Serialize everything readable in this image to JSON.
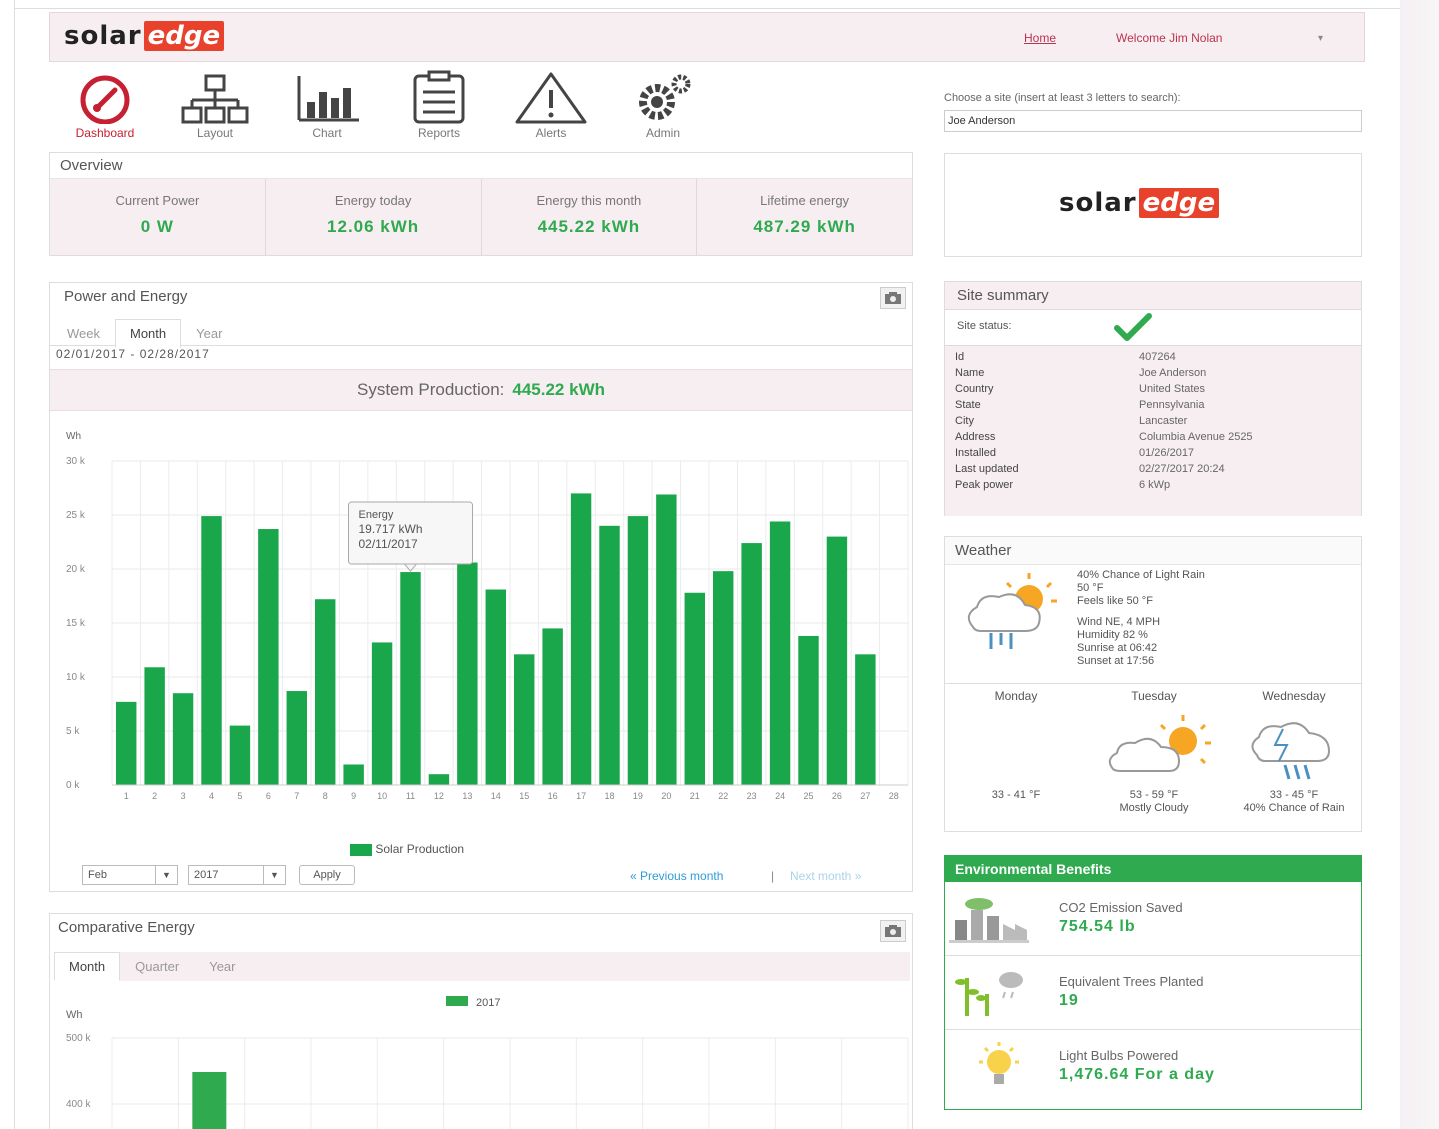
{
  "brand": {
    "solar": "solar",
    "edge": "edge"
  },
  "topbar": {
    "home_label": "Home",
    "welcome_label": "Welcome Jim Nolan",
    "caret": "▾"
  },
  "nav": [
    {
      "label": "Dashboard",
      "icon": "dashboard-icon"
    },
    {
      "label": "Layout",
      "icon": "layout-icon"
    },
    {
      "label": "Chart",
      "icon": "chart-icon"
    },
    {
      "label": "Reports",
      "icon": "reports-icon"
    },
    {
      "label": "Alerts",
      "icon": "alerts-icon"
    },
    {
      "label": "Admin",
      "icon": "admin-icon"
    }
  ],
  "site_chooser": {
    "label": "Choose a site (insert at least 3 letters to search):",
    "value": "Joe Anderson"
  },
  "overview": {
    "title": "Overview",
    "cards": [
      {
        "title": "Current Power",
        "value": "0 W"
      },
      {
        "title": "Energy today",
        "value": "12.06 kWh"
      },
      {
        "title": "Energy this month",
        "value": "445.22 kWh"
      },
      {
        "title": "Lifetime energy",
        "value": "487.29 kWh"
      }
    ]
  },
  "power_energy": {
    "title": "Power and Energy",
    "tabs": [
      "Week",
      "Month",
      "Year"
    ],
    "active_tab": "Month",
    "date_range": "02/01/2017 - 02/28/2017",
    "production_label": "System Production:",
    "production_value": "445.22 kWh",
    "legend": "Solar Production",
    "month_select": "Feb",
    "year_select": "2017",
    "apply_label": "Apply",
    "prev_label": "« Previous month",
    "separator": "|",
    "next_label": "Next month »",
    "tooltip": {
      "line1": "Energy",
      "line2": "19.717 kWh",
      "line3": "02/11/2017"
    }
  },
  "chart_data": [
    {
      "type": "bar",
      "ylabel": "Wh",
      "ylim": [
        0,
        30000
      ],
      "y_ticks": [
        "0 k",
        "5 k",
        "10 k",
        "15 k",
        "20 k",
        "25 k",
        "30 k"
      ],
      "categories": [
        "1",
        "2",
        "3",
        "4",
        "5",
        "6",
        "7",
        "8",
        "9",
        "10",
        "11",
        "12",
        "13",
        "14",
        "15",
        "16",
        "17",
        "18",
        "19",
        "20",
        "21",
        "22",
        "23",
        "24",
        "25",
        "26",
        "27",
        "28"
      ],
      "series": [
        {
          "name": "Solar Production",
          "color": "#1aa64b",
          "values": [
            7700,
            10900,
            8500,
            24900,
            5500,
            23700,
            8700,
            17200,
            1900,
            13200,
            19717,
            1000,
            20600,
            18100,
            12100,
            14500,
            27000,
            24000,
            24900,
            26900,
            17800,
            19800,
            22400,
            24400,
            13800,
            23000,
            12100,
            null
          ]
        }
      ],
      "grid": true
    },
    {
      "type": "bar",
      "ylabel": "Wh",
      "y_ticks": [
        "400 k",
        "500 k"
      ],
      "series": [
        {
          "name": "2017",
          "color": "#2faa4f"
        }
      ],
      "grid": true
    }
  ],
  "comparative": {
    "title": "Comparative Energy",
    "tabs": [
      "Month",
      "Quarter",
      "Year"
    ],
    "active_tab": "Month",
    "legend": "2017"
  },
  "site_summary": {
    "title": "Site summary",
    "status_label": "Site status:",
    "rows": [
      {
        "k": "Id",
        "v": "407264"
      },
      {
        "k": "Name",
        "v": "Joe Anderson"
      },
      {
        "k": "Country",
        "v": "United States"
      },
      {
        "k": "State",
        "v": "Pennsylvania"
      },
      {
        "k": "City",
        "v": "Lancaster"
      },
      {
        "k": "Address",
        "v": "Columbia Avenue 2525"
      },
      {
        "k": "Installed",
        "v": "01/26/2017"
      },
      {
        "k": "Last updated",
        "v": "02/27/2017 20:24"
      },
      {
        "k": "Peak power",
        "v": "6 kWp"
      }
    ]
  },
  "weather": {
    "title": "Weather",
    "current": [
      "40% Chance of Light Rain",
      "50 °F",
      "Feels like 50 °F",
      "",
      "Wind NE, 4 MPH",
      "Humidity 82 %",
      "Sunrise at 06:42",
      "Sunset at 17:56"
    ],
    "days": [
      {
        "name": "Monday",
        "temp": "33 - 41 °F",
        "desc": ""
      },
      {
        "name": "Tuesday",
        "temp": "53 - 59 °F",
        "desc": "Mostly Cloudy"
      },
      {
        "name": "Wednesday",
        "temp": "33 - 45 °F",
        "desc": "40% Chance of Rain"
      }
    ]
  },
  "env": {
    "title": "Environmental Benefits",
    "items": [
      {
        "label": "CO2 Emission Saved",
        "value": "754.54 lb"
      },
      {
        "label": "Equivalent Trees Planted",
        "value": "19"
      },
      {
        "label": "Light Bulbs Powered",
        "value": "1,476.64 For a day"
      }
    ]
  },
  "colors": {
    "accent": "#2faa4f",
    "brand_red": "#e8412c",
    "pink_bg": "#f7eef2"
  }
}
